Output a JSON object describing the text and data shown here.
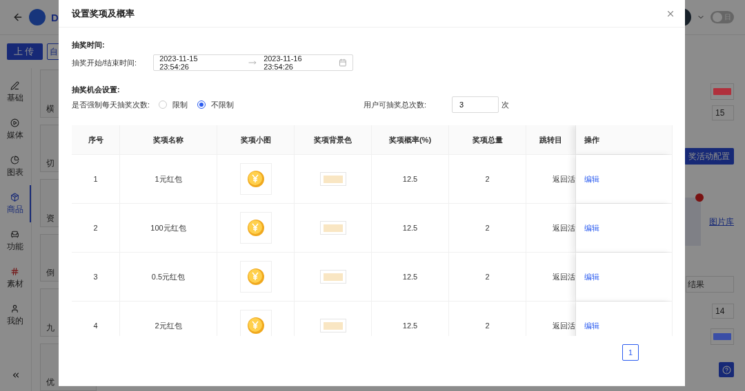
{
  "background_app": {
    "brand": "D",
    "upload_button": "上传",
    "second_button": "自",
    "theme_toggle": {
      "label": "日",
      "on": false
    },
    "nav": [
      {
        "label": "基础",
        "selected": false
      },
      {
        "label": "媒体",
        "selected": false
      },
      {
        "label": "图表",
        "selected": false
      },
      {
        "label": "商品",
        "selected": true
      },
      {
        "label": "功能",
        "selected": false
      },
      {
        "label": "素材",
        "selected": false
      },
      {
        "label": "我的",
        "selected": false
      }
    ],
    "cards": [
      "横",
      "切",
      "资",
      "倒",
      "九",
      "优"
    ],
    "right_panel": {
      "swatches": [
        {
          "color": "#b0303c"
        },
        {
          "color": "#3a4ea6"
        }
      ],
      "size_value": "15",
      "config_button": "奖活动配置",
      "library_link": "图片库",
      "result_field": "结果",
      "font_value": "14"
    }
  },
  "modal": {
    "title": "设置奖项及概率",
    "time_section": "抽奖时间:",
    "time_label": "抽奖开始/结束时间:",
    "start_time": "2023-11-15 23:54:26",
    "end_time": "2023-11-16 23:54:26",
    "chance_section": "抽奖机会设置:",
    "limit_label": "是否强制每天抽奖次数:",
    "limit_options": [
      {
        "label": "限制",
        "selected": false
      },
      {
        "label": "不限制",
        "selected": true
      }
    ],
    "total_label": "用户可抽奖总次数:",
    "total_value": "3",
    "total_unit": "次",
    "table": {
      "columns": [
        "序号",
        "奖项名称",
        "奖项小图",
        "奖项背景色",
        "奖项概率(%)",
        "奖项总量",
        "跳转目",
        "操作"
      ],
      "rows": [
        {
          "index": "1",
          "name": "1元红包",
          "color": "#f9e6c3",
          "probability": "12.5",
          "quantity": "2",
          "target": "返回活",
          "action": "编辑"
        },
        {
          "index": "2",
          "name": "100元红包",
          "color": "#f9e6c3",
          "probability": "12.5",
          "quantity": "2",
          "target": "返回活",
          "action": "编辑"
        },
        {
          "index": "3",
          "name": "0.5元红包",
          "color": "#f9e6c3",
          "probability": "12.5",
          "quantity": "2",
          "target": "返回活",
          "action": "编辑"
        },
        {
          "index": "4",
          "name": "2元红包",
          "color": "#f9e6c3",
          "probability": "12.5",
          "quantity": "2",
          "target": "返回活",
          "action": "编辑"
        }
      ]
    },
    "pagination": [
      {
        "label": "1",
        "selected": true
      }
    ]
  }
}
